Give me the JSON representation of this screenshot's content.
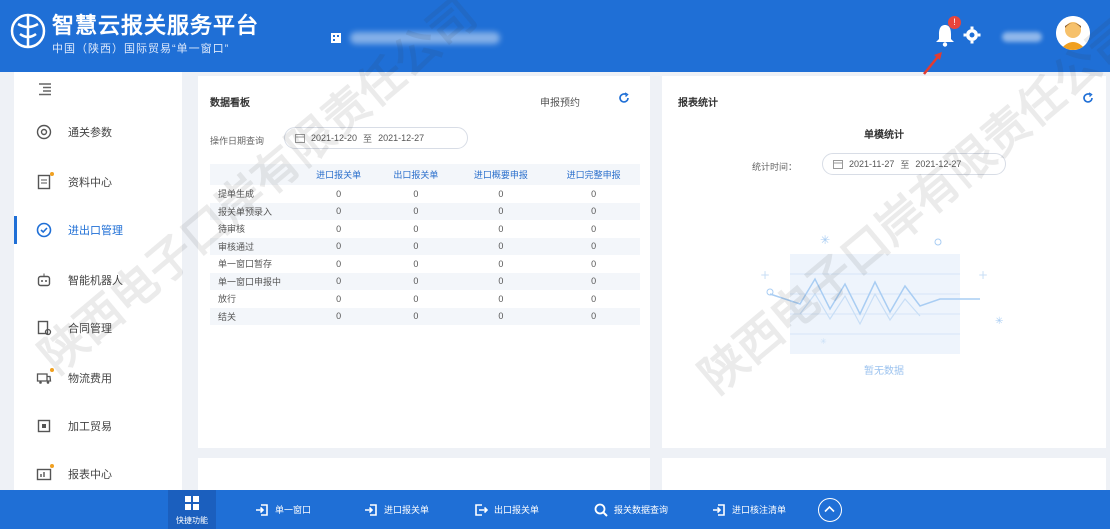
{
  "header": {
    "title": "智慧云报关服务平台",
    "subtitle": "中国（陕西）国际贸易“单一窗口”",
    "notification_count": "!"
  },
  "sidebar": {
    "items": [
      {
        "label": "通关参数",
        "icon": "gear-circle-icon"
      },
      {
        "label": "资料中心",
        "icon": "file-icon"
      },
      {
        "label": "进出口管理",
        "icon": "check-circle-icon"
      },
      {
        "label": "智能机器人",
        "icon": "robot-icon"
      },
      {
        "label": "合同管理",
        "icon": "contract-icon"
      },
      {
        "label": "物流费用",
        "icon": "truck-icon"
      },
      {
        "label": "加工贸易",
        "icon": "processing-icon"
      },
      {
        "label": "报表中心",
        "icon": "report-icon"
      }
    ]
  },
  "dashboard": {
    "title": "数据看板",
    "declare_link": "申报预约",
    "date_label": "操作日期查询",
    "date_from": "2021-12-20",
    "date_to_word": "至",
    "date_to": "2021-12-27",
    "columns": [
      "",
      "进口报关单",
      "出口报关单",
      "进口概要申报",
      "进口完整申报"
    ],
    "rows": [
      {
        "label": "提单生成",
        "values": [
          "0",
          "0",
          "0",
          "0"
        ]
      },
      {
        "label": "报关单预录入",
        "values": [
          "0",
          "0",
          "0",
          "0"
        ]
      },
      {
        "label": "待审核",
        "values": [
          "0",
          "0",
          "0",
          "0"
        ]
      },
      {
        "label": "审核通过",
        "values": [
          "0",
          "0",
          "0",
          "0"
        ]
      },
      {
        "label": "单一窗口暂存",
        "values": [
          "0",
          "0",
          "0",
          "0"
        ]
      },
      {
        "label": "单一窗口申报中",
        "values": [
          "0",
          "0",
          "0",
          "0"
        ]
      },
      {
        "label": "放行",
        "values": [
          "0",
          "0",
          "0",
          "0"
        ]
      },
      {
        "label": "结关",
        "values": [
          "0",
          "0",
          "0",
          "0"
        ]
      }
    ]
  },
  "stats": {
    "title": "报表统计",
    "chart_title": "单模统计",
    "date_label": "统计时间：",
    "date_from": "2021-11-27",
    "date_to_word": "至",
    "date_to": "2021-12-27",
    "empty_text": "暂无数据"
  },
  "bottombar": {
    "quick_label": "快捷功能",
    "items": [
      {
        "label": "单一窗口",
        "icon": "login-icon"
      },
      {
        "label": "进口报关单",
        "icon": "login-icon"
      },
      {
        "label": "出口报关单",
        "icon": "logout-icon"
      },
      {
        "label": "报关数据查询",
        "icon": "search-icon"
      },
      {
        "label": "进口核注清单",
        "icon": "login-icon"
      }
    ]
  },
  "watermark": {
    "text1": "陕西电子口岸有限责任公司",
    "text2": "陕西电子口岸有限责任公司"
  },
  "colors": {
    "brand": "#1f6fd6",
    "accent_badge": "#e8453c",
    "panel_bg": "#ffffff",
    "page_bg": "#eef1f6"
  }
}
